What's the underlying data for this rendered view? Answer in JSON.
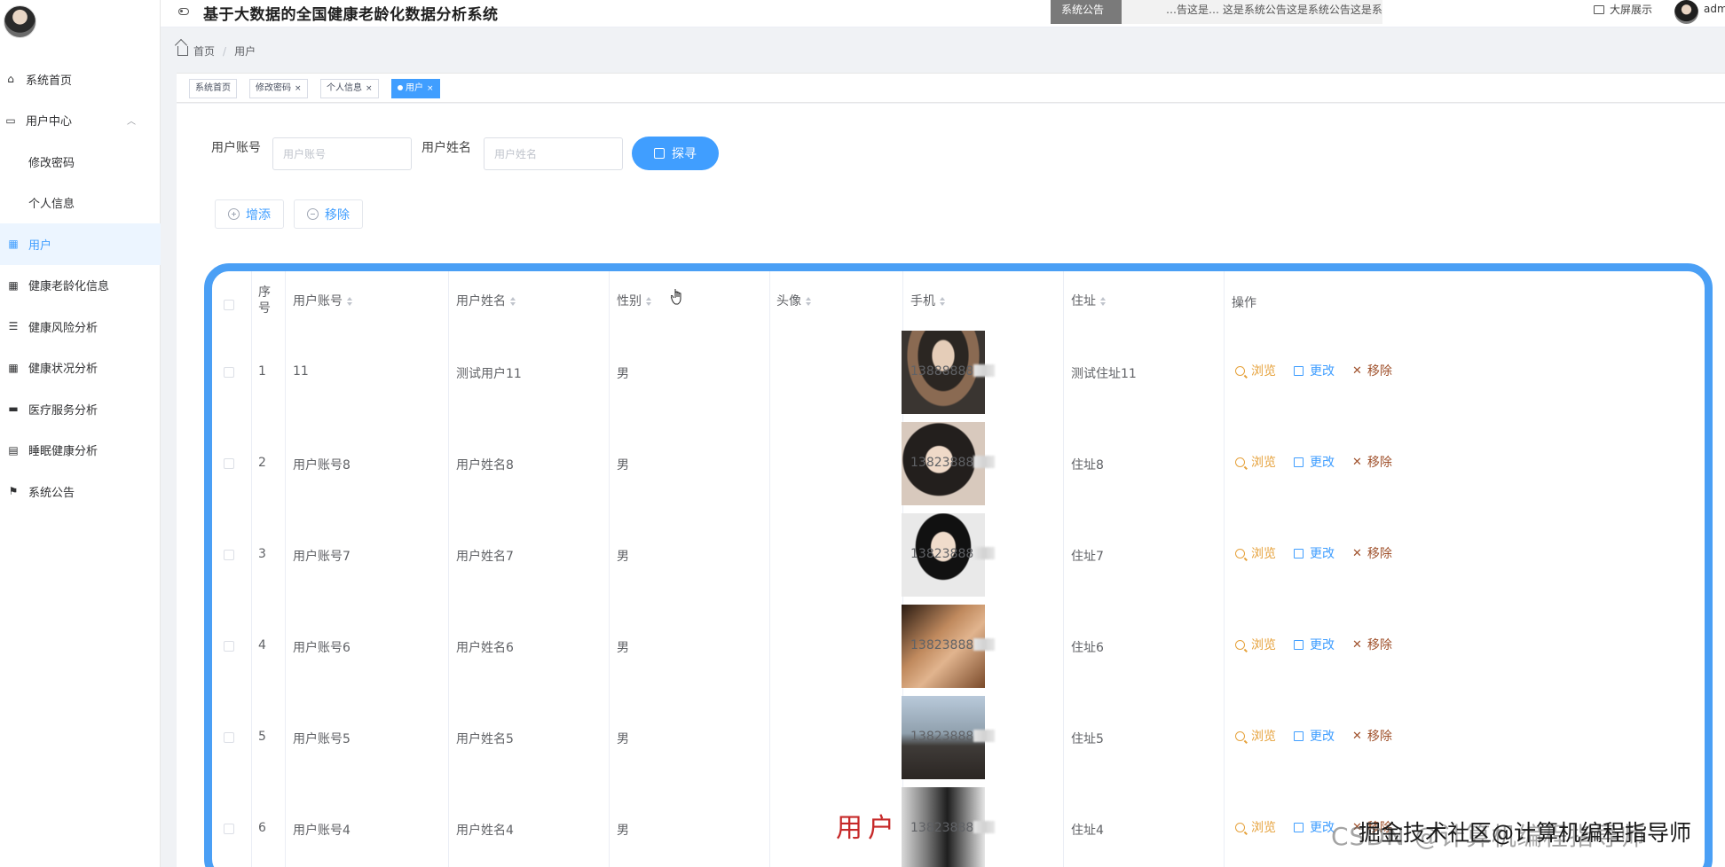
{
  "header": {
    "title": "基于大数据的全国健康老龄化数据分析系统",
    "notice_tag": "系统公告",
    "notice_text": "…告这是…  这是系统公告这是系统公告这是系统公告这",
    "screen_button": "大屏展示",
    "user": "adm"
  },
  "sidebar": {
    "items": [
      {
        "label": "系统首页",
        "icon": "home-icon"
      },
      {
        "label": "用户中心",
        "icon": "user-center-icon"
      },
      {
        "label": "修改密码"
      },
      {
        "label": "个人信息"
      },
      {
        "label": "用户",
        "icon": "grid-icon"
      },
      {
        "label": "健康老龄化信息",
        "icon": "grid-icon"
      },
      {
        "label": "健康风险分析",
        "icon": "list-icon"
      },
      {
        "label": "健康状况分析",
        "icon": "grid-icon"
      },
      {
        "label": "医疗服务分析",
        "icon": "monitor-icon"
      },
      {
        "label": "睡眠健康分析",
        "icon": "clipboard-icon"
      },
      {
        "label": "系统公告",
        "icon": "flag-icon"
      }
    ]
  },
  "breadcrumb": {
    "home": "首页",
    "current": "用户"
  },
  "tags": [
    {
      "label": "系统首页"
    },
    {
      "label": "修改密码"
    },
    {
      "label": "个人信息"
    },
    {
      "label": "用户"
    }
  ],
  "search": {
    "account_label": "用户账号",
    "account_placeholder": "用户账号",
    "name_label": "用户姓名",
    "name_placeholder": "用户姓名",
    "button": "探寻"
  },
  "actions": {
    "add": "增添",
    "remove": "移除"
  },
  "table": {
    "headers": {
      "index": "序号",
      "account": "用户账号",
      "name": "用户姓名",
      "gender": "性别",
      "avatar": "头像",
      "phone": "手机",
      "address": "住址",
      "ops": "操作"
    },
    "row_actions": {
      "view": "浏览",
      "edit": "更改",
      "delete": "移除"
    },
    "rows": [
      {
        "index": "1",
        "account": "11",
        "name": "测试用户11",
        "gender": "男",
        "phone": "13888888",
        "address": "测试住址11"
      },
      {
        "index": "2",
        "account": "用户账号8",
        "name": "用户姓名8",
        "gender": "男",
        "phone": "13823888",
        "address": "住址8"
      },
      {
        "index": "3",
        "account": "用户账号7",
        "name": "用户姓名7",
        "gender": "男",
        "phone": "13823888",
        "address": "住址7"
      },
      {
        "index": "4",
        "account": "用户账号6",
        "name": "用户姓名6",
        "gender": "男",
        "phone": "13823888",
        "address": "住址6"
      },
      {
        "index": "5",
        "account": "用户账号5",
        "name": "用户姓名5",
        "gender": "男",
        "phone": "13823888",
        "address": "住址5"
      },
      {
        "index": "6",
        "account": "用户账号4",
        "name": "用户姓名4",
        "gender": "男",
        "phone": "13823888",
        "address": "住址4"
      }
    ]
  },
  "watermark": {
    "big": "用户",
    "csdn": "CSDN @计算机编程指导师",
    "juejin": "掘金技术社区@计算机编程指导师"
  },
  "colors": {
    "primary": "#409eff",
    "table_border": "#4a9ff5",
    "view": "#e6a23c",
    "delete": "#a0522d"
  }
}
